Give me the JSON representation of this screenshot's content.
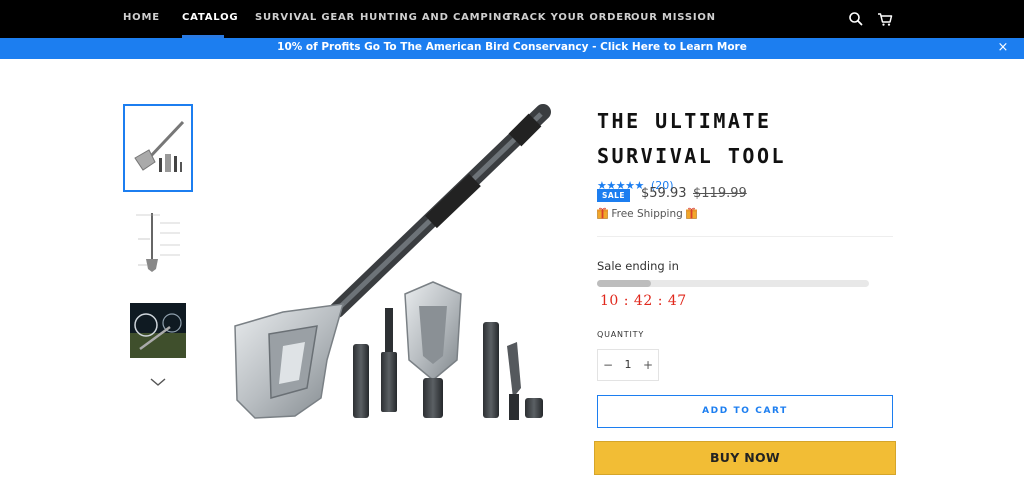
{
  "nav": {
    "items": [
      {
        "label": "HOME",
        "active": false
      },
      {
        "label": "CATALOG",
        "active": true
      },
      {
        "label": "SURVIVAL GEAR",
        "active": false
      },
      {
        "label": "HUNTING AND CAMPING",
        "active": false
      },
      {
        "label": "TRACK YOUR ORDER",
        "active": false
      },
      {
        "label": "OUR MISSION",
        "active": false
      }
    ],
    "icons": [
      "search-icon",
      "cart-icon"
    ]
  },
  "announcement": {
    "text": "10% of Profits Go To The American Bird Conservancy - Click Here to Learn More",
    "close_label": "×"
  },
  "gallery": {
    "thumbnails": [
      "shovel-kit",
      "dimension-diagram",
      "field-photo"
    ],
    "selected_index": 0,
    "more_icon": "chevron-down-icon"
  },
  "product": {
    "title": "THE ULTIMATE SURVIVAL TOOL",
    "stars": "★★★★★",
    "review_count": "(20)",
    "sale_badge": "SALE",
    "price": "$59.93",
    "compare_price": "$119.99",
    "shipping": "Free Shipping",
    "sale_label": "Sale ending in",
    "sale_progress": 0.2,
    "countdown": "10 : 42 : 47",
    "quantity_label": "QUANTITY",
    "quantity_value": "1",
    "minus_label": "−",
    "plus_label": "+",
    "add_to_cart": "ADD TO CART",
    "buy_now": "BUY NOW"
  },
  "colors": {
    "accent": "#1c7ef0",
    "countdown": "#e0281c",
    "buy_now": "#f2bd35",
    "nav_bg": "#000000"
  }
}
